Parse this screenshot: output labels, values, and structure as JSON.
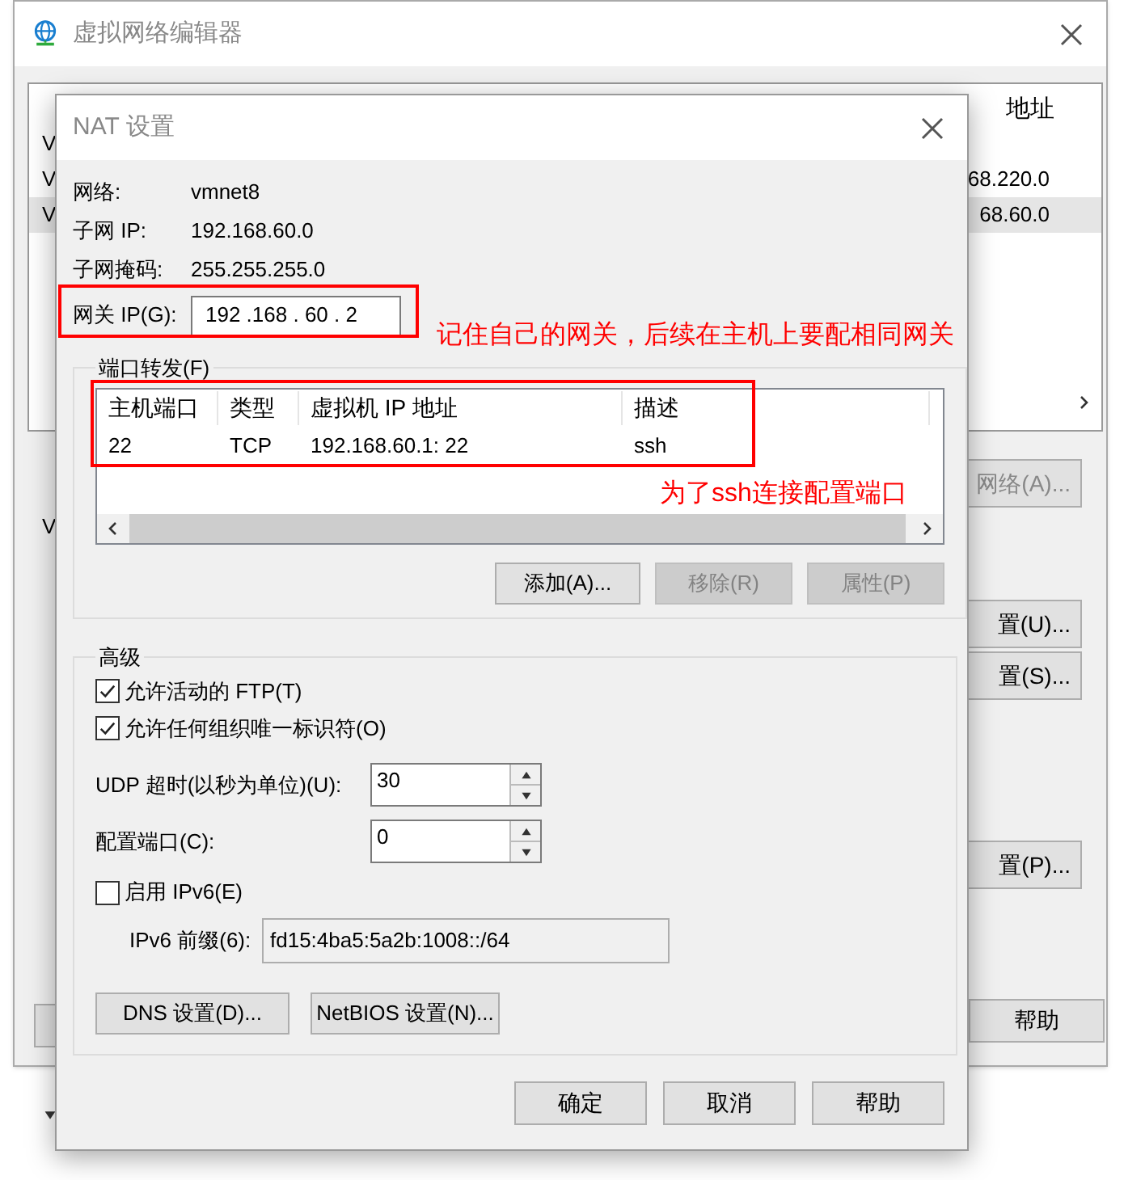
{
  "background_window": {
    "title": "虚拟网络编辑器",
    "column": "地址",
    "rows": [
      {
        "name": "V",
        "selected": false
      },
      {
        "name": "V",
        "subnet": "68.220.0",
        "selected": false
      },
      {
        "name": "V",
        "subnet": "68.60.0",
        "selected": true
      }
    ],
    "group_label": "V",
    "buttons": [
      "网络(A)...",
      "置(U)...",
      "置(S)...",
      "置(P)..."
    ],
    "help_button": "帮助"
  },
  "nat_dialog": {
    "title": "NAT 设置",
    "info": [
      {
        "label": "网络:",
        "value": "vmnet8"
      },
      {
        "label": "子网 IP:",
        "value": "192.168.60.0"
      },
      {
        "label": "子网掩码:",
        "value": "255.255.255.0"
      }
    ],
    "gateway": {
      "label": "网关 IP(G):",
      "value": "192 .168 . 60 . 2"
    },
    "port_forwarding": {
      "title": "端口转发(F)",
      "columns": [
        "主机端口",
        "类型",
        "虚拟机 IP 地址",
        "描述"
      ],
      "rows": [
        [
          "22",
          "TCP",
          "192.168.60.1: 22",
          "ssh"
        ]
      ],
      "buttons": [
        {
          "label": "添加(A)...",
          "disabled": false
        },
        {
          "label": "移除(R)",
          "disabled": true
        },
        {
          "label": "属性(P)",
          "disabled": true
        }
      ]
    },
    "advanced": {
      "title": "高级",
      "options": [
        {
          "label": "允许活动的 FTP(T)",
          "checked": true
        },
        {
          "label": "允许任何组织唯一标识符(O)",
          "checked": true
        }
      ],
      "spinners": [
        {
          "label": "UDP 超时(以秒为单位)(U):",
          "value": "30"
        },
        {
          "label": "配置端口(C):",
          "value": "0"
        }
      ],
      "ipv6": {
        "label": "启用 IPv6(E)",
        "checked": false
      },
      "prefix": {
        "label": "IPv6 前缀(6):",
        "value": "fd15:4ba5:5a2b:1008::/64",
        "disabled": true
      },
      "buttons": [
        "DNS 设置(D)...",
        "NetBIOS 设置(N)..."
      ]
    },
    "buttons": [
      "确定",
      "取消",
      "帮助"
    ]
  },
  "annotations": [
    {
      "text": "记住自己的网关，后续在主机上要配相同网关"
    },
    {
      "text": "为了ssh连接配置端口"
    }
  ]
}
